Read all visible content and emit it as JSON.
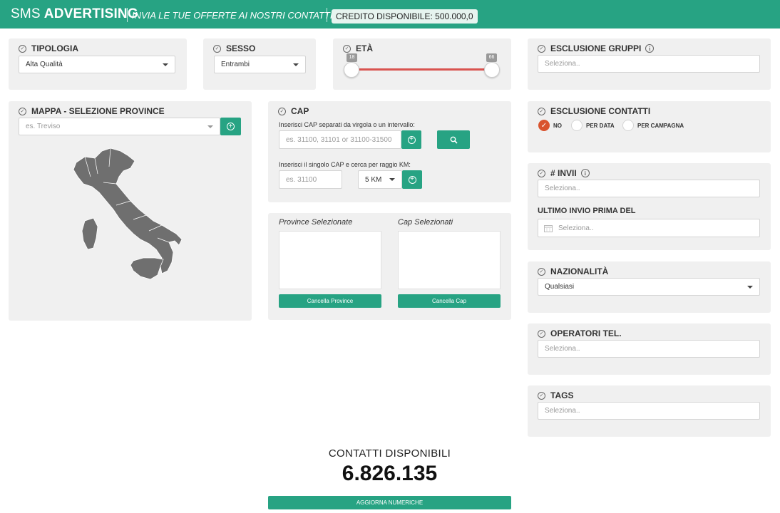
{
  "header": {
    "brand_light": "SMS",
    "brand_bold": "ADVERTISING",
    "tagline": "INVIA LE TUE OFFERTE AI NOSTRI CONTATTI SMS",
    "credit": "CREDITO DISPONIBILE: 500.000,0"
  },
  "tipologia": {
    "title": "TIPOLOGIA",
    "value": "Alta Qualità"
  },
  "sesso": {
    "title": "SESSO",
    "value": "Entrambi"
  },
  "eta": {
    "title": "ETÀ",
    "min_label": "18",
    "max_label": "66",
    "min": 18,
    "max": 66
  },
  "esclusione_gruppi": {
    "title": "ESCLUSIONE GRUPPI",
    "placeholder": "Seleziona.."
  },
  "mappa": {
    "title": "MAPPA - SELEZIONE PROVINCE",
    "placeholder": "es. Treviso"
  },
  "cap": {
    "title": "CAP",
    "label_multi": "Inserisci CAP separati da virgola o un intervallo:",
    "placeholder_multi": "es. 31100, 31101 or 31100-31500",
    "label_single": "Inserisci il singolo CAP e cerca per raggio KM:",
    "placeholder_single": "es. 31100",
    "radius": "5 KM"
  },
  "esclusione_contatti": {
    "title": "ESCLUSIONE CONTATTI",
    "options": [
      "NO",
      "PER DATA",
      "PER CAMPAGNA"
    ],
    "selected": "NO"
  },
  "invii": {
    "title": "# INVII",
    "placeholder": "Seleziona..",
    "subtitle": "ULTIMO INVIO PRIMA DEL",
    "date_placeholder": "Seleziona.."
  },
  "selezioni": {
    "province_title": "Province Selezionate",
    "cap_title": "Cap Selezionati",
    "province_button": "Cancella Province",
    "cap_button": "Cancella Cap"
  },
  "nazionalita": {
    "title": "NAZIONALITÀ",
    "value": "Qualsiasi"
  },
  "operatori": {
    "title": "OPERATORI TEL.",
    "placeholder": "Seleziona.."
  },
  "tags": {
    "title": "TAGS",
    "placeholder": "Seleziona.."
  },
  "totals": {
    "label": "CONTATTI DISPONIBILI",
    "value": "6.826.135",
    "button": "AGGIORNA NUMERICHE"
  },
  "colors": {
    "accent": "#27a383",
    "slider": "#d9534f",
    "radio_selected": "#d9542f",
    "panel": "#f0f0f0"
  }
}
